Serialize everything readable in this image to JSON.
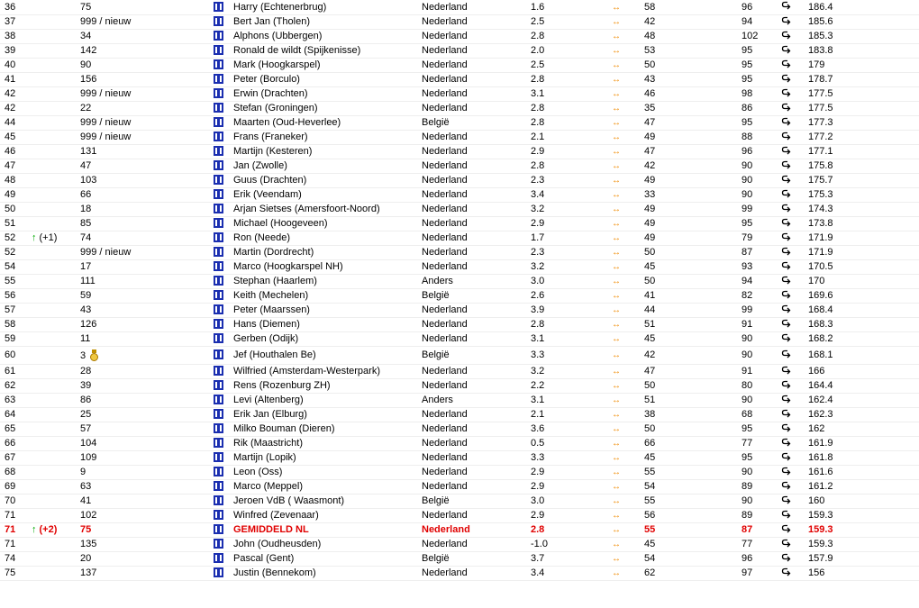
{
  "colors": {
    "highlight": "#e00000",
    "trend_up": "#00aa00",
    "trend_arrow": "#f08a00",
    "gear_blue": "#1a2eb0"
  },
  "icons": {
    "gear": "gear-icon",
    "left_right": "left-right-arrow-icon",
    "return": "return-arrow-icon",
    "medal": "medal-icon",
    "trend": "up-arrow-icon"
  },
  "rows": [
    {
      "rank": "36",
      "trend": "",
      "prev": "75",
      "medal": false,
      "name": "Harry (Echtenerbrug)",
      "country": "Nederland",
      "v1": "1.6",
      "v2": "58",
      "v3": "96",
      "score": "186.4"
    },
    {
      "rank": "37",
      "trend": "",
      "prev": "999 / nieuw",
      "medal": false,
      "name": "Bert Jan (Tholen)",
      "country": "Nederland",
      "v1": "2.5",
      "v2": "42",
      "v3": "94",
      "score": "185.6"
    },
    {
      "rank": "38",
      "trend": "",
      "prev": "34",
      "medal": false,
      "name": "Alphons (Ubbergen)",
      "country": "Nederland",
      "v1": "2.8",
      "v2": "48",
      "v3": "102",
      "score": "185.3"
    },
    {
      "rank": "39",
      "trend": "",
      "prev": "142",
      "medal": false,
      "name": "Ronald de wildt (Spijkenisse)",
      "country": "Nederland",
      "v1": "2.0",
      "v2": "53",
      "v3": "95",
      "score": "183.8"
    },
    {
      "rank": "40",
      "trend": "",
      "prev": "90",
      "medal": false,
      "name": "Mark (Hoogkarspel)",
      "country": "Nederland",
      "v1": "2.5",
      "v2": "50",
      "v3": "95",
      "score": "179"
    },
    {
      "rank": "41",
      "trend": "",
      "prev": "156",
      "medal": false,
      "name": "Peter (Borculo)",
      "country": "Nederland",
      "v1": "2.8",
      "v2": "43",
      "v3": "95",
      "score": "178.7"
    },
    {
      "rank": "42",
      "trend": "",
      "prev": "999 / nieuw",
      "medal": false,
      "name": "Erwin (Drachten)",
      "country": "Nederland",
      "v1": "3.1",
      "v2": "46",
      "v3": "98",
      "score": "177.5"
    },
    {
      "rank": "42",
      "trend": "",
      "prev": "22",
      "medal": false,
      "name": "Stefan (Groningen)",
      "country": "Nederland",
      "v1": "2.8",
      "v2": "35",
      "v3": "86",
      "score": "177.5"
    },
    {
      "rank": "44",
      "trend": "",
      "prev": "999 / nieuw",
      "medal": false,
      "name": "Maarten (Oud-Heverlee)",
      "country": "België",
      "v1": "2.8",
      "v2": "47",
      "v3": "95",
      "score": "177.3"
    },
    {
      "rank": "45",
      "trend": "",
      "prev": "999 / nieuw",
      "medal": false,
      "name": "Frans (Franeker)",
      "country": "Nederland",
      "v1": "2.1",
      "v2": "49",
      "v3": "88",
      "score": "177.2"
    },
    {
      "rank": "46",
      "trend": "",
      "prev": "131",
      "medal": false,
      "name": "Martijn (Kesteren)",
      "country": "Nederland",
      "v1": "2.9",
      "v2": "47",
      "v3": "96",
      "score": "177.1"
    },
    {
      "rank": "47",
      "trend": "",
      "prev": "47",
      "medal": false,
      "name": "Jan (Zwolle)",
      "country": "Nederland",
      "v1": "2.8",
      "v2": "42",
      "v3": "90",
      "score": "175.8"
    },
    {
      "rank": "48",
      "trend": "",
      "prev": "103",
      "medal": false,
      "name": "Guus (Drachten)",
      "country": "Nederland",
      "v1": "2.3",
      "v2": "49",
      "v3": "90",
      "score": "175.7"
    },
    {
      "rank": "49",
      "trend": "",
      "prev": "66",
      "medal": false,
      "name": "Erik (Veendam)",
      "country": "Nederland",
      "v1": "3.4",
      "v2": "33",
      "v3": "90",
      "score": "175.3"
    },
    {
      "rank": "50",
      "trend": "",
      "prev": "18",
      "medal": false,
      "name": "Arjan Sietses (Amersfoort-Noord)",
      "country": "Nederland",
      "v1": "3.2",
      "v2": "49",
      "v3": "99",
      "score": "174.3"
    },
    {
      "rank": "51",
      "trend": "",
      "prev": "85",
      "medal": false,
      "name": "Michael (Hoogeveen)",
      "country": "Nederland",
      "v1": "2.9",
      "v2": "49",
      "v3": "95",
      "score": "173.8"
    },
    {
      "rank": "52",
      "trend": "(+1)",
      "prev": "74",
      "medal": false,
      "name": "Ron (Neede)",
      "country": "Nederland",
      "v1": "1.7",
      "v2": "49",
      "v3": "79",
      "score": "171.9"
    },
    {
      "rank": "52",
      "trend": "",
      "prev": "999 / nieuw",
      "medal": false,
      "name": "Martin (Dordrecht)",
      "country": "Nederland",
      "v1": "2.3",
      "v2": "50",
      "v3": "87",
      "score": "171.9"
    },
    {
      "rank": "54",
      "trend": "",
      "prev": "17",
      "medal": false,
      "name": "Marco (Hoogkarspel NH)",
      "country": "Nederland",
      "v1": "3.2",
      "v2": "45",
      "v3": "93",
      "score": "170.5"
    },
    {
      "rank": "55",
      "trend": "",
      "prev": "111",
      "medal": false,
      "name": "Stephan (Haarlem)",
      "country": "Anders",
      "v1": "3.0",
      "v2": "50",
      "v3": "94",
      "score": "170"
    },
    {
      "rank": "56",
      "trend": "",
      "prev": "59",
      "medal": false,
      "name": "Keith (Mechelen)",
      "country": "België",
      "v1": "2.6",
      "v2": "41",
      "v3": "82",
      "score": "169.6"
    },
    {
      "rank": "57",
      "trend": "",
      "prev": "43",
      "medal": false,
      "name": "Peter (Maarssen)",
      "country": "Nederland",
      "v1": "3.9",
      "v2": "44",
      "v3": "99",
      "score": "168.4"
    },
    {
      "rank": "58",
      "trend": "",
      "prev": "126",
      "medal": false,
      "name": "Hans (Diemen)",
      "country": "Nederland",
      "v1": "2.8",
      "v2": "51",
      "v3": "91",
      "score": "168.3"
    },
    {
      "rank": "59",
      "trend": "",
      "prev": "11",
      "medal": false,
      "name": "Gerben (Odijk)",
      "country": "Nederland",
      "v1": "3.1",
      "v2": "45",
      "v3": "90",
      "score": "168.2"
    },
    {
      "rank": "60",
      "trend": "",
      "prev": "3",
      "medal": true,
      "name": "Jef (Houthalen Be)",
      "country": "België",
      "v1": "3.3",
      "v2": "42",
      "v3": "90",
      "score": "168.1"
    },
    {
      "rank": "61",
      "trend": "",
      "prev": "28",
      "medal": false,
      "name": "Wilfried (Amsterdam-Westerpark)",
      "country": "Nederland",
      "v1": "3.2",
      "v2": "47",
      "v3": "91",
      "score": "166"
    },
    {
      "rank": "62",
      "trend": "",
      "prev": "39",
      "medal": false,
      "name": "Rens (Rozenburg ZH)",
      "country": "Nederland",
      "v1": "2.2",
      "v2": "50",
      "v3": "80",
      "score": "164.4"
    },
    {
      "rank": "63",
      "trend": "",
      "prev": "86",
      "medal": false,
      "name": "Levi (Altenberg)",
      "country": "Anders",
      "v1": "3.1",
      "v2": "51",
      "v3": "90",
      "score": "162.4"
    },
    {
      "rank": "64",
      "trend": "",
      "prev": "25",
      "medal": false,
      "name": "Erik Jan (Elburg)",
      "country": "Nederland",
      "v1": "2.1",
      "v2": "38",
      "v3": "68",
      "score": "162.3"
    },
    {
      "rank": "65",
      "trend": "",
      "prev": "57",
      "medal": false,
      "name": "Milko Bouman (Dieren)",
      "country": "Nederland",
      "v1": "3.6",
      "v2": "50",
      "v3": "95",
      "score": "162"
    },
    {
      "rank": "66",
      "trend": "",
      "prev": "104",
      "medal": false,
      "name": "Rik (Maastricht)",
      "country": "Nederland",
      "v1": "0.5",
      "v2": "66",
      "v3": "77",
      "score": "161.9"
    },
    {
      "rank": "67",
      "trend": "",
      "prev": "109",
      "medal": false,
      "name": "Martijn (Lopik)",
      "country": "Nederland",
      "v1": "3.3",
      "v2": "45",
      "v3": "95",
      "score": "161.8"
    },
    {
      "rank": "68",
      "trend": "",
      "prev": "9",
      "medal": false,
      "name": "Leon (Oss)",
      "country": "Nederland",
      "v1": "2.9",
      "v2": "55",
      "v3": "90",
      "score": "161.6"
    },
    {
      "rank": "69",
      "trend": "",
      "prev": "63",
      "medal": false,
      "name": "Marco (Meppel)",
      "country": "Nederland",
      "v1": "2.9",
      "v2": "54",
      "v3": "89",
      "score": "161.2"
    },
    {
      "rank": "70",
      "trend": "",
      "prev": "41",
      "medal": false,
      "name": "Jeroen VdB ( Waasmont)",
      "country": "België",
      "v1": "3.0",
      "v2": "55",
      "v3": "90",
      "score": "160"
    },
    {
      "rank": "71",
      "trend": "",
      "prev": "102",
      "medal": false,
      "name": "Winfred (Zevenaar)",
      "country": "Nederland",
      "v1": "2.9",
      "v2": "56",
      "v3": "89",
      "score": "159.3"
    },
    {
      "rank": "71",
      "trend": "(+2)",
      "prev": "75",
      "medal": false,
      "highlight": true,
      "name": "GEMIDDELD NL",
      "country": "Nederland",
      "v1": "2.8",
      "v2": "55",
      "v3": "87",
      "score": "159.3"
    },
    {
      "rank": "71",
      "trend": "",
      "prev": "135",
      "medal": false,
      "name": "John (Oudheusden)",
      "country": "Nederland",
      "v1": "-1.0",
      "v2": "45",
      "v3": "77",
      "score": "159.3"
    },
    {
      "rank": "74",
      "trend": "",
      "prev": "20",
      "medal": false,
      "name": "Pascal (Gent)",
      "country": "België",
      "v1": "3.7",
      "v2": "54",
      "v3": "96",
      "score": "157.9"
    },
    {
      "rank": "75",
      "trend": "",
      "prev": "137",
      "medal": false,
      "name": "Justin (Bennekom)",
      "country": "Nederland",
      "v1": "3.4",
      "v2": "62",
      "v3": "97",
      "score": "156"
    }
  ]
}
